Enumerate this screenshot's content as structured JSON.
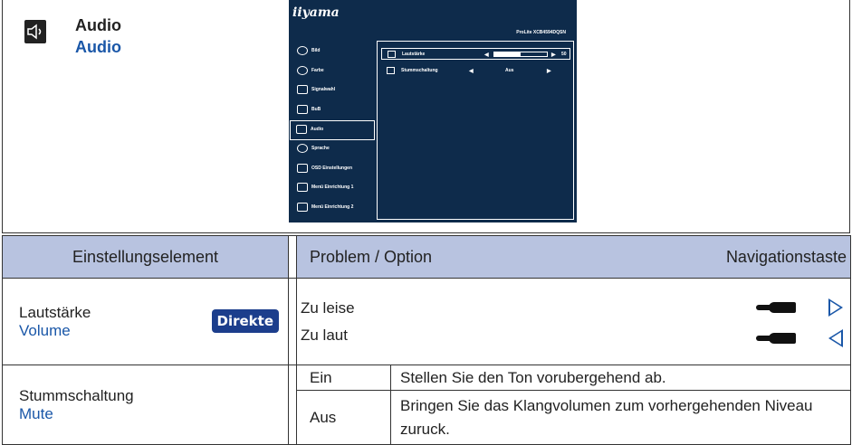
{
  "section": {
    "title_de": "Audio",
    "title_en": "Audio",
    "icon": "speaker-icon"
  },
  "osd": {
    "brand": "iiyama",
    "model": "ProLite XCB4594DQSN",
    "menu": [
      {
        "label": "Bild",
        "icon": "brightness-icon"
      },
      {
        "label": "Farbe",
        "icon": "color-icon"
      },
      {
        "label": "Signalwahl",
        "icon": "input-icon"
      },
      {
        "label": "BuB",
        "icon": "pip-icon"
      },
      {
        "label": "Audio",
        "icon": "speaker-icon",
        "selected": true
      },
      {
        "label": "Sprache",
        "icon": "globe-icon"
      },
      {
        "label": "OSD Einstellungen",
        "icon": "osd-icon"
      },
      {
        "label": "Menü Einrichtung 1",
        "icon": "sliders-icon"
      },
      {
        "label": "Menü Einrichtung 2",
        "icon": "sliders-icon"
      }
    ],
    "volume_label": "Lautstärke",
    "volume_value": "50",
    "volume_fraction": 0.5,
    "mute_label": "Stummschaltung",
    "mute_value": "Aus"
  },
  "table": {
    "headers": {
      "element": "Einstellungselement",
      "option": "Problem / Option",
      "nav": "Navigationstaste"
    },
    "volume": {
      "name_de": "Lautstärke",
      "name_en": "Volume",
      "badge": "Direkte",
      "opt1": "Zu leise",
      "opt2": "Zu laut"
    },
    "mute": {
      "name_de": "Stummschaltung",
      "name_en": "Mute",
      "on_label": "Ein",
      "on_desc": "Stellen Sie den Ton vorubergehend ab.",
      "off_label": "Aus",
      "off_desc": "Bringen Sie das Klangvolumen zum vorhergehenden Niveau zuruck."
    }
  },
  "colors": {
    "header_bg": "#b8c3e0",
    "osd_bg": "#0e2b4b",
    "accent_blue": "#1a57a8",
    "badge_bg": "#1c3e8c"
  }
}
